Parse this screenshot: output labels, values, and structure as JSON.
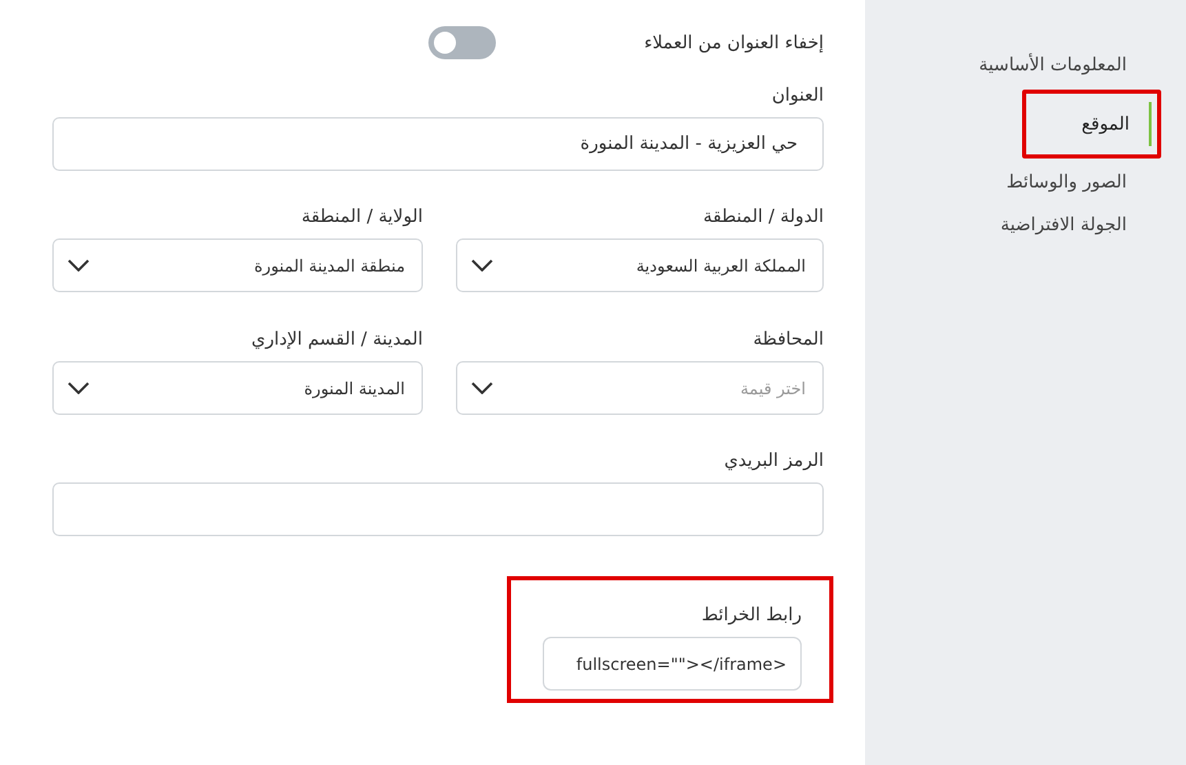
{
  "sidebar": {
    "items": [
      {
        "label": "المعلومات الأساسية",
        "selected": false,
        "highlighted": false
      },
      {
        "label": "الموقع",
        "selected": true,
        "highlighted": true
      },
      {
        "label": "الصور والوسائط",
        "selected": false,
        "highlighted": false
      },
      {
        "label": "الجولة الافتراضية",
        "selected": false,
        "highlighted": false
      }
    ]
  },
  "hide_address": {
    "label": "إخفاء العنوان من العملاء",
    "on": false
  },
  "address": {
    "label": "العنوان",
    "value": "حي العزيزية - المدينة المنورة"
  },
  "selects": [
    {
      "label": "الدولة / المنطقة",
      "value": "المملكة العربية السعودية"
    },
    {
      "label": "الولاية / المنطقة",
      "value": "منطقة المدينة المنورة"
    },
    {
      "label": "المحافظة",
      "placeholder": "اختر قيمة"
    },
    {
      "label": "المدينة / القسم الإداري",
      "value": "المدينة المنورة"
    }
  ],
  "postal_code": {
    "label": "الرمز البريدي"
  },
  "map_link": {
    "label": "رابط الخرائط",
    "value": "fullscreen=\"\"></iframe>",
    "highlighted": true
  }
}
